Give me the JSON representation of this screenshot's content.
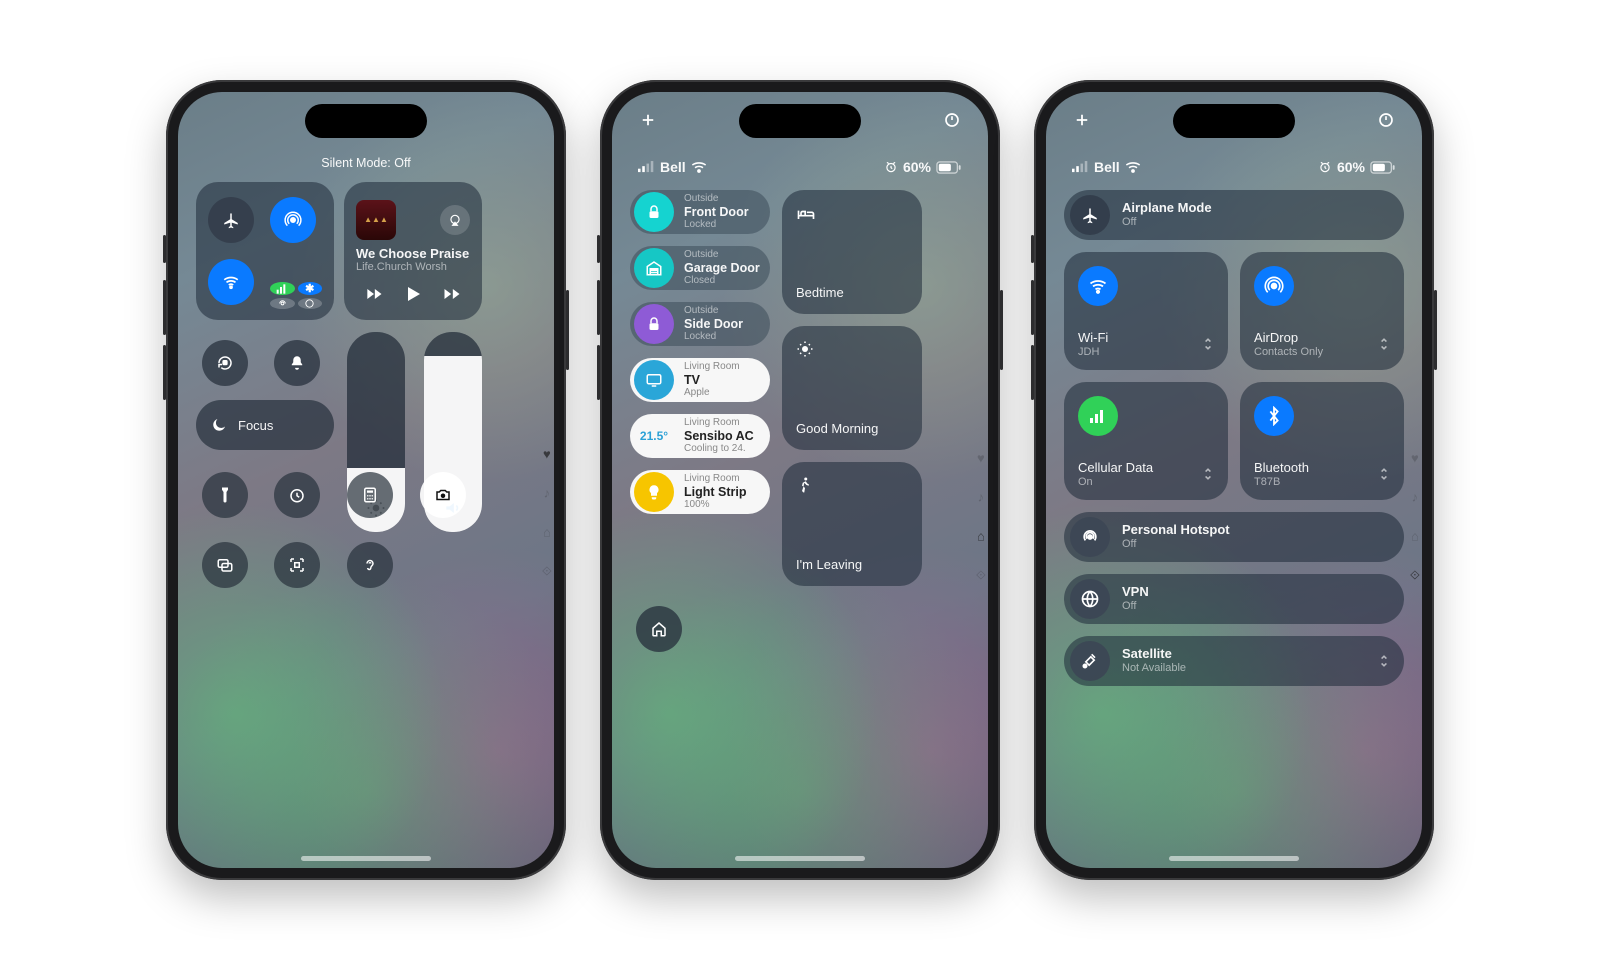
{
  "phone1": {
    "banner": "Silent Mode: Off",
    "music": {
      "title": "We Choose Praise",
      "artist": "Life.Church Worsh"
    },
    "focus_label": "Focus",
    "brightness_pct": 32,
    "volume_pct": 88,
    "pager": [
      "heart",
      "music",
      "home",
      "radio"
    ]
  },
  "phone2": {
    "status": {
      "carrier": "Bell",
      "battery": "60%"
    },
    "home_items": [
      {
        "room": "Outside",
        "name": "Front Door",
        "state": "Locked",
        "icon": "lock",
        "color": "#15d3d0"
      },
      {
        "room": "Outside",
        "name": "Garage Door",
        "state": "Closed",
        "icon": "garage",
        "color": "#16c7c5"
      },
      {
        "room": "Outside",
        "name": "Side Door",
        "state": "Locked",
        "icon": "lock",
        "color": "#8e5bd6"
      },
      {
        "room": "Living Room",
        "name": "TV",
        "state": "Apple",
        "icon": "tv",
        "color": "#2aa6d8",
        "white": true
      },
      {
        "room": "Living Room",
        "name": "Sensibo AC",
        "state": "Cooling to 24.",
        "icon": "temp",
        "temp": "21.5°",
        "white": true
      },
      {
        "room": "Living Room",
        "name": "Light Strip",
        "state": "100%",
        "icon": "bulb",
        "color": "#f7c500",
        "white": true
      }
    ],
    "scenes": [
      {
        "name": "Bedtime",
        "icon": "bed"
      },
      {
        "name": "Good Morning",
        "icon": "sun"
      },
      {
        "name": "I'm Leaving",
        "icon": "walk"
      }
    ],
    "pager": [
      "heart",
      "music",
      "home",
      "radio"
    ]
  },
  "phone3": {
    "status": {
      "carrier": "Bell",
      "battery": "60%"
    },
    "airplane": {
      "title": "Airplane Mode",
      "state": "Off"
    },
    "conn": [
      {
        "title": "Wi-Fi",
        "sub": "JDH",
        "icon": "wifi",
        "on": true
      },
      {
        "title": "AirDrop",
        "sub": "Contacts Only",
        "icon": "airdrop",
        "on": true
      },
      {
        "title": "Cellular Data",
        "sub": "On",
        "icon": "cell",
        "on": true,
        "color": "#30d158"
      },
      {
        "title": "Bluetooth",
        "sub": "T87B",
        "icon": "bt",
        "on": true
      }
    ],
    "rows": [
      {
        "title": "Personal Hotspot",
        "sub": "Off",
        "icon": "hotspot"
      },
      {
        "title": "VPN",
        "sub": "Off",
        "icon": "vpn"
      },
      {
        "title": "Satellite",
        "sub": "Not Available",
        "icon": "sat",
        "chev": true
      }
    ],
    "pager": [
      "heart",
      "music",
      "home",
      "radio"
    ]
  }
}
